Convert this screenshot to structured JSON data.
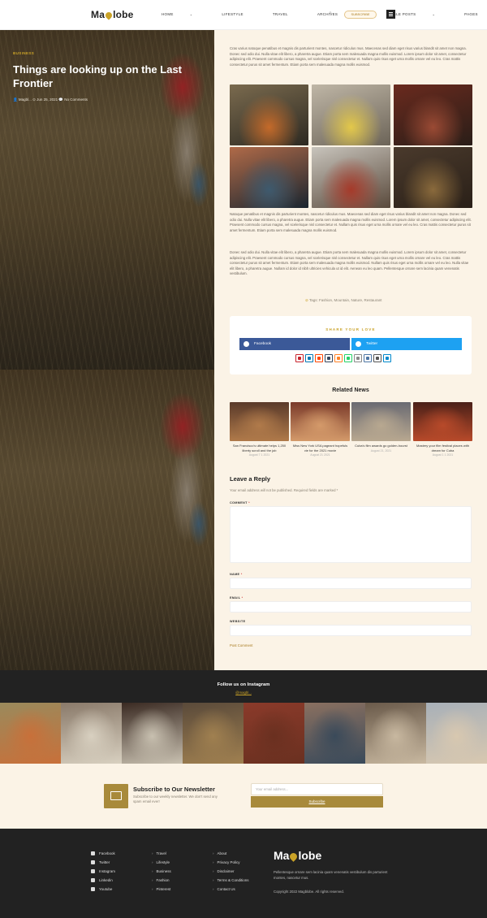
{
  "header": {
    "logo": {
      "pre": "Ma",
      "post": "lobe"
    },
    "nav": [
      {
        "label": "Home",
        "caret": true
      },
      {
        "label": "Lifestyle",
        "caret": false
      },
      {
        "label": "Travel",
        "caret": false
      },
      {
        "label": "Archives",
        "caret": true
      },
      {
        "label": "Single Posts",
        "caret": true
      },
      {
        "label": "Pages",
        "caret": true
      }
    ],
    "subscribe_label": "Subscribe",
    "icons": {
      "search": "search-icon",
      "menu": "menu-icon"
    }
  },
  "hero": {
    "category": "Business",
    "title": "Things are looking up on the Last Frontier",
    "meta": "👤 Magbl...   ⊙ Jun 25, 2021   💬 No Comments"
  },
  "article": {
    "para1": "Cras varius natoque penatibus et magnis dis parturient montes, nascetur ridiculus mus. Maecenas sed diam eget risus varius blandit sit amet non magna. Donec sed odio dui. Nulla vitae elit libero, a pharetra augue. Etiam porta sem malesuada magna mollis euismod. Lorem ipsum dolor sit amet, consectetur adipiscing elit. Praesent commodo cursus magna, vel scelerisque nisl consectetur et. Nullam quis risus eget urna mollis ornare vel eu leo. Cras mattis consectetur purus sit amet fermentum. Etiam porta sem malesuada magna mollis euismod.",
    "para2": "Natoque penatibus et magnis dis parturient montes, nascetur ridiculus mus. Maecenas sed diam eget risus varius blandit sit amet non magna. Donec sed odio dui. Nulla vitae elit libero, a pharetra augue. Etiam porta sem malesuada magna mollis euismod. Lorem ipsum dolor sit amet, consectetur adipiscing elit. Praesent commodo cursus magna, vel scelerisque nisl consectetur et. Nullam quis risus eget urna mollis ornare vel eu leo. Cras mattis consectetur purus sit amet fermentum. Etiam porta sem malesuada magna mollis euismod.",
    "para3": "Donec sed odio dui. Nulla vitae elit libero, a pharetra augue. Etiam porta sem malesuada magna mollis euismod. Lorem ipsum dolor sit amet, consectetur adipiscing elit. Praesent commodo cursus magna, vel scelerisque nisl consectetur et. Nullam quis risus eget urna mollis ornare vel eu leo. Cras mattis consectetur purus sit amet fermentum. Etiam porta sem malesuada magna mollis euismod. Nullam quis risus eget urna mollis ornare vel eu leo. Nulla vitae elit libero, a pharetra augue. Nullam id dolor id nibh ultricies vehicula ut id elit. Aenean eu leo quam. Pellentesque ornare sem lacinia quam venenatis vestibulum.",
    "gallery": [
      {
        "a": "#7a6a4e",
        "b": "#c46a2a",
        "c": "#2d2a22"
      },
      {
        "a": "#bfb6a6",
        "b": "#e3c84a",
        "c": "#6c6458"
      },
      {
        "a": "#6a2a1e",
        "b": "#9a4a34",
        "c": "#2a1e18"
      },
      {
        "a": "#b06a48",
        "b": "#3e5a6e",
        "c": "#1a2630"
      },
      {
        "a": "#c8c4bc",
        "b": "#a63a2a",
        "c": "#5a4a3c"
      },
      {
        "a": "#4a3a2c",
        "b": "#8a6a3c",
        "c": "#2a2018"
      }
    ],
    "tags": "Tags: Fashion, Mountain, Nature, Restaurant"
  },
  "share": {
    "title": "Share your love",
    "facebook": "Facebook",
    "twitter": "Twitter",
    "more": [
      {
        "name": "pinterest-icon",
        "color": "#c8232c"
      },
      {
        "name": "linkedin-icon",
        "color": "#0077b5"
      },
      {
        "name": "reddit-icon",
        "color": "#ff4500"
      },
      {
        "name": "tumblr-icon",
        "color": "#35465c"
      },
      {
        "name": "mix-icon",
        "color": "#ff8226"
      },
      {
        "name": "whatsapp-icon",
        "color": "#25d366"
      },
      {
        "name": "email-icon",
        "color": "#888888"
      },
      {
        "name": "vk-icon",
        "color": "#4c75a3"
      },
      {
        "name": "print-icon",
        "color": "#555555"
      },
      {
        "name": "telegram-icon",
        "color": "#0088cc"
      }
    ]
  },
  "related": {
    "heading": "Related News",
    "items": [
      {
        "title": "San Francisco's ultimate helps 1,250 liberty scroll and the job",
        "date": "August 7 1 2021",
        "c1": "#5a3a2a",
        "c2": "#b07a4a"
      },
      {
        "title": "Miss New York USA pageant hopefuls vie for the 2021 movie",
        "date": "August 21 2021",
        "c1": "#7a3a2a",
        "c2": "#d49a6a"
      },
      {
        "title": "Cuba's film awards go golden-hourst",
        "date": "August 21, 2021",
        "c1": "#6a6a72",
        "c2": "#b8a890"
      },
      {
        "title": "Mastery your film festival places with dream for Cuba",
        "date": "August 1 1 2021",
        "c1": "#4a2018",
        "c2": "#b84a2a"
      }
    ]
  },
  "reply": {
    "heading": "Leave a Reply",
    "note": "Your email address will not be published. Required fields are marked *",
    "comment_label": "Comment",
    "name_label": "Name",
    "email_label": "Email",
    "website_label": "Website",
    "req": "*",
    "submit": "Post Comment"
  },
  "instagram": {
    "title": "Follow us on Instagram",
    "handle": "@magbl...",
    "tiles": [
      {
        "a": "#9a8a5c",
        "b": "#c8703a"
      },
      {
        "a": "#8a7a6a",
        "b": "#d8d0c0"
      },
      {
        "a": "#3a2a22",
        "b": "#c8c0b0"
      },
      {
        "a": "#5a4a3a",
        "b": "#a08050"
      },
      {
        "a": "#8a3a2a",
        "b": "#6a3020"
      },
      {
        "a": "#8a7060",
        "b": "#3a4a5a"
      },
      {
        "a": "#6a5a4a",
        "b": "#c8b8a0"
      },
      {
        "a": "#a8b0b8",
        "b": "#d8c8b0"
      }
    ]
  },
  "newsletter": {
    "heading": "Subscribe to Our Newsletter",
    "desc": "Subscribe to our weekly newsletter. We don't send any spam email ever!",
    "placeholder": "Your email address...",
    "button": "Subscribe"
  },
  "footer": {
    "social": [
      "Facebook",
      "Twitter",
      "Instagram",
      "Linkedin",
      "Youtube"
    ],
    "cats": [
      "Travel",
      "Lifestyle",
      "Business",
      "Fashion",
      "Pinterest"
    ],
    "links": [
      "About",
      "Privacy Policy",
      "Disclaimer",
      "Terms & Conditions",
      "Contact Us"
    ],
    "logo": {
      "pre": "Ma",
      "post": "lobe"
    },
    "desc": "Pellentesque ornare sem lacinia quam venenatis vestibulum dis parturient montes, nascetur mus.",
    "copyright": "Copyright 2022 Magblobe. All rights reserved."
  },
  "colors": {
    "accent": "#c9a227",
    "accent_dark": "#a88a3b",
    "cream": "#fbf3e6",
    "dark": "#222222",
    "facebook": "#3b5998",
    "twitter": "#1da1f2"
  }
}
